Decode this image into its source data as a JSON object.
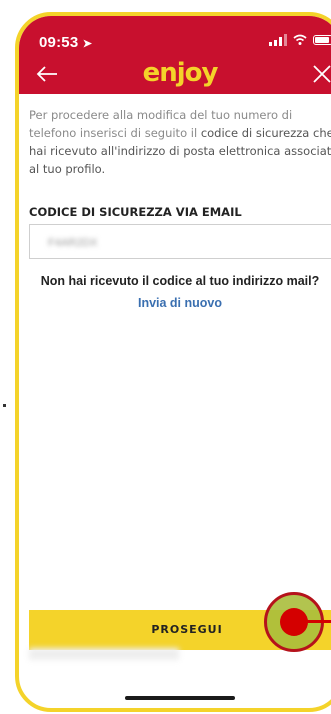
{
  "status_bar": {
    "time": "09:53"
  },
  "header": {
    "logo": "enjoy",
    "background_color": "#c8102e",
    "logo_color": "#f4d32a"
  },
  "content": {
    "intro_part1": "Per procedere alla modifica del tuo numero di telefono inserisci di seguito il ",
    "intro_em": "codice di sicurezza che hai ricevuto all'indirizzo di posta elettronica associato al tuo profilo.",
    "code_label": "CODICE DI SICUREZZA VIA EMAIL",
    "code_value": "F4AR2DX",
    "not_received": "Non hai ricevuto il codice al tuo indirizzo mail?",
    "resend": "Invia di nuovo"
  },
  "actions": {
    "continue_label": "PROSEGUI",
    "button_color": "#f4d32a"
  },
  "icons": [
    "back-arrow-icon",
    "close-icon",
    "location-arrow-icon",
    "signal-icon",
    "wifi-icon",
    "battery-icon"
  ]
}
